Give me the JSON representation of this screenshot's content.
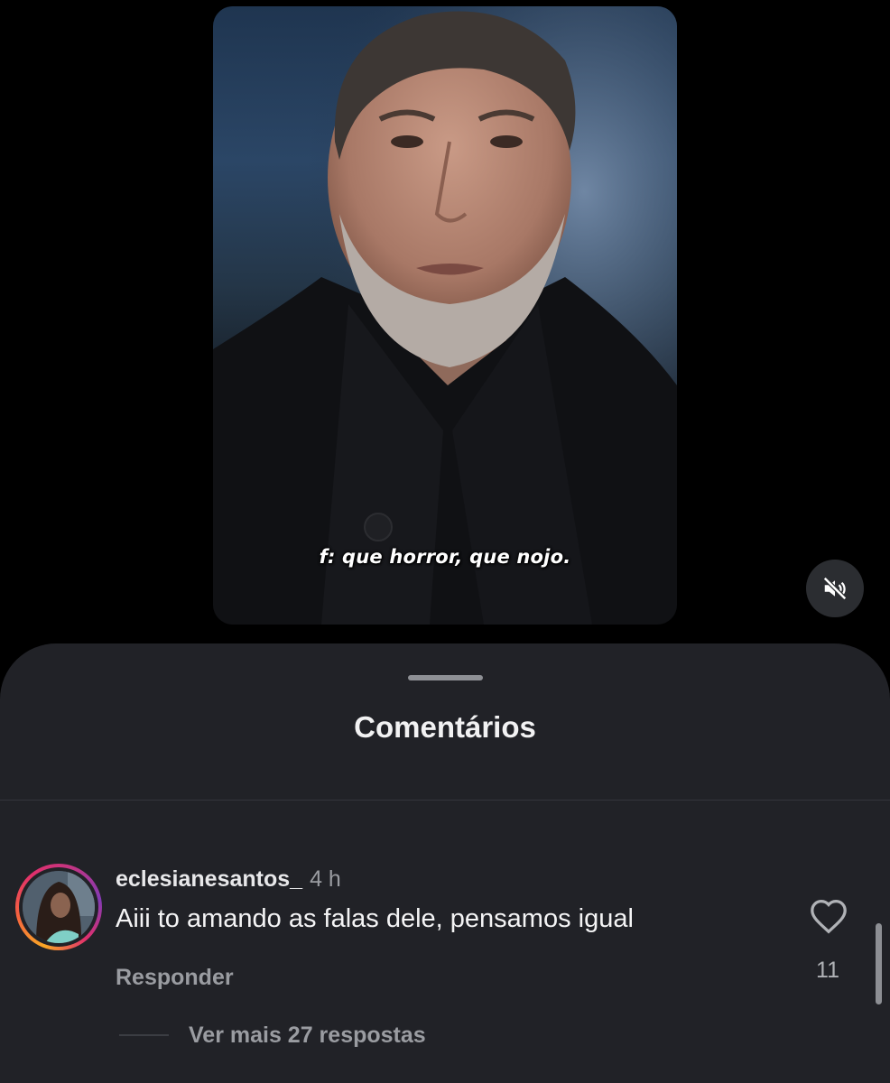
{
  "video": {
    "caption": "f: que horror, que nojo.",
    "mute_icon": "speaker-muted-icon"
  },
  "comments_sheet": {
    "title": "Comentários",
    "comment": {
      "username": "eclesianesantos_",
      "time": "4 h",
      "text": "Aiii to amando as falas dele, pensamos igual",
      "reply_label": "Responder",
      "like_icon": "heart-outline-icon",
      "like_count": "11",
      "view_more_label": "Ver mais 27 respostas"
    }
  },
  "colors": {
    "background": "#000000",
    "sheet": "#212227",
    "text_primary": "#f4f4f5",
    "text_secondary": "#9a9ca1",
    "story_ring": [
      "#f9a825",
      "#e1306c",
      "#833ab4"
    ]
  }
}
